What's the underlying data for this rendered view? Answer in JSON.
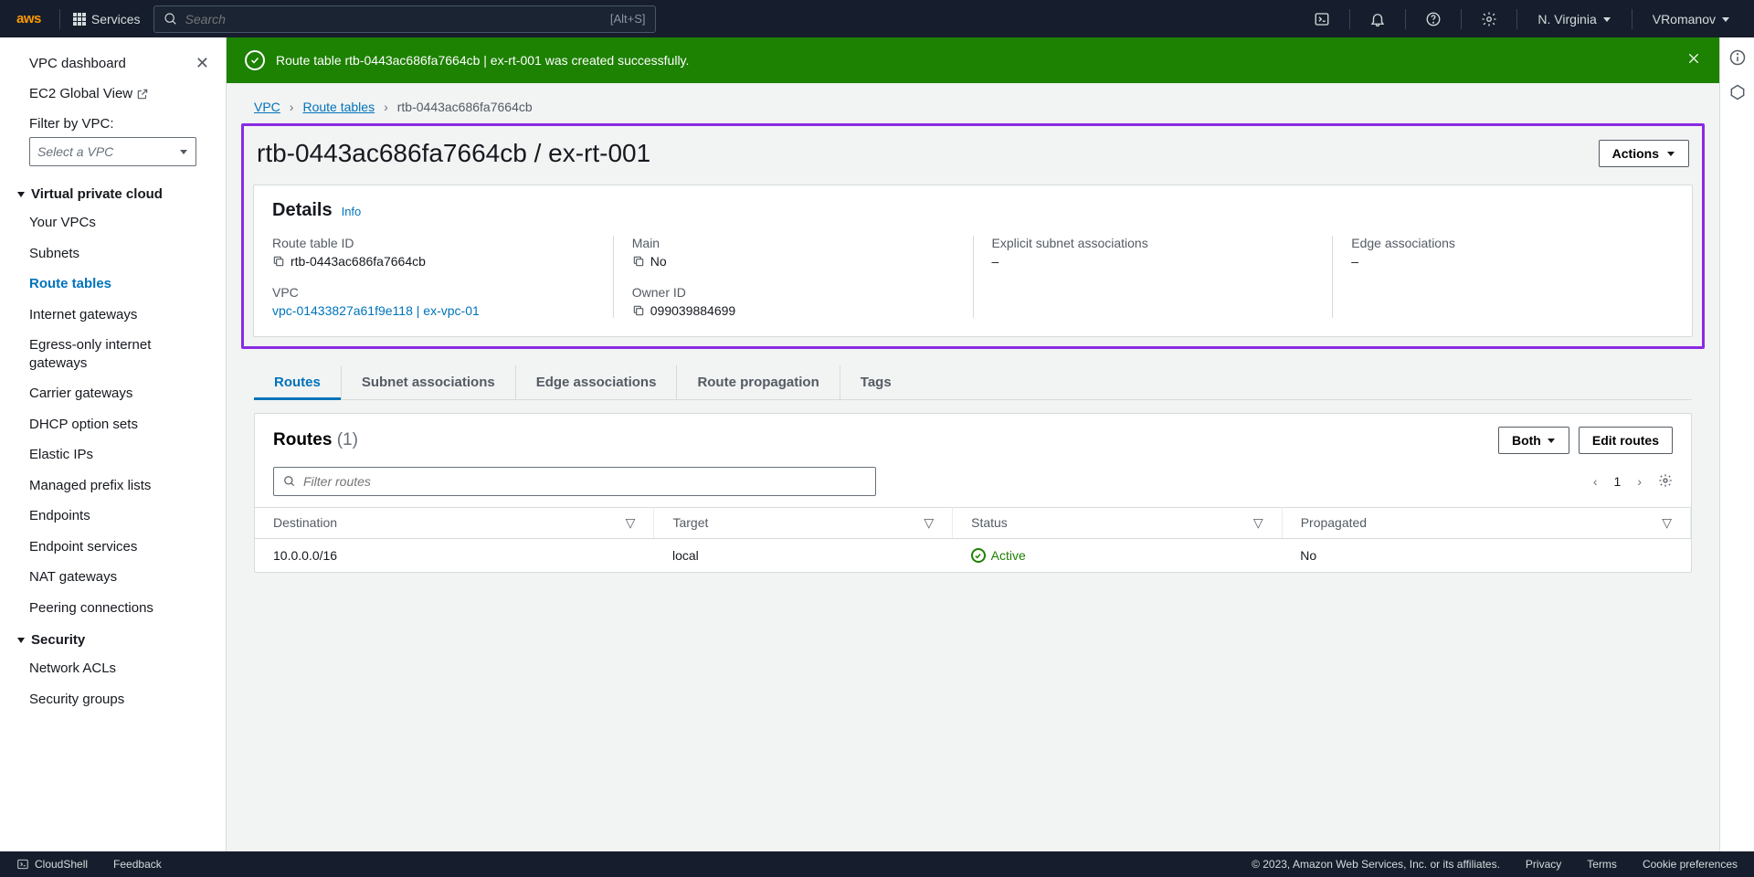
{
  "topnav": {
    "logo": "aws",
    "services": "Services",
    "search_placeholder": "Search",
    "shortcut": "[Alt+S]",
    "region": "N. Virginia",
    "user": "VRomanov"
  },
  "sidebar": {
    "vpc_dashboard": "VPC dashboard",
    "ec2_global": "EC2 Global View",
    "filter_label": "Filter by VPC:",
    "select_placeholder": "Select a VPC",
    "sections": [
      {
        "title": "Virtual private cloud",
        "items": [
          "Your VPCs",
          "Subnets",
          "Route tables",
          "Internet gateways",
          "Egress-only internet gateways",
          "Carrier gateways",
          "DHCP option sets",
          "Elastic IPs",
          "Managed prefix lists",
          "Endpoints",
          "Endpoint services",
          "NAT gateways",
          "Peering connections"
        ],
        "active_index": 2
      },
      {
        "title": "Security",
        "items": [
          "Network ACLs",
          "Security groups"
        ]
      }
    ]
  },
  "success": {
    "message": "Route table rtb-0443ac686fa7664cb | ex-rt-001 was created successfully."
  },
  "breadcrumb": {
    "vpc": "VPC",
    "route_tables": "Route tables",
    "current": "rtb-0443ac686fa7664cb"
  },
  "page_title": "rtb-0443ac686fa7664cb / ex-rt-001",
  "actions_label": "Actions",
  "details": {
    "heading": "Details",
    "info": "Info",
    "route_table_id": {
      "label": "Route table ID",
      "value": "rtb-0443ac686fa7664cb"
    },
    "main": {
      "label": "Main",
      "value": "No"
    },
    "subnet_assoc": {
      "label": "Explicit subnet associations",
      "value": "–"
    },
    "edge_assoc": {
      "label": "Edge associations",
      "value": "–"
    },
    "vpc": {
      "label": "VPC",
      "value": "vpc-01433827a61f9e118 | ex-vpc-01"
    },
    "owner": {
      "label": "Owner ID",
      "value": "099039884699"
    }
  },
  "tabs": [
    "Routes",
    "Subnet associations",
    "Edge associations",
    "Route propagation",
    "Tags"
  ],
  "routes": {
    "title": "Routes",
    "count": "(1)",
    "both": "Both",
    "edit": "Edit routes",
    "filter_placeholder": "Filter routes",
    "page": "1",
    "columns": [
      "Destination",
      "Target",
      "Status",
      "Propagated"
    ],
    "rows": [
      {
        "destination": "10.0.0.0/16",
        "target": "local",
        "status": "Active",
        "propagated": "No"
      }
    ]
  },
  "footer": {
    "cloudshell": "CloudShell",
    "feedback": "Feedback",
    "copyright": "© 2023, Amazon Web Services, Inc. or its affiliates.",
    "privacy": "Privacy",
    "terms": "Terms",
    "cookies": "Cookie preferences"
  }
}
